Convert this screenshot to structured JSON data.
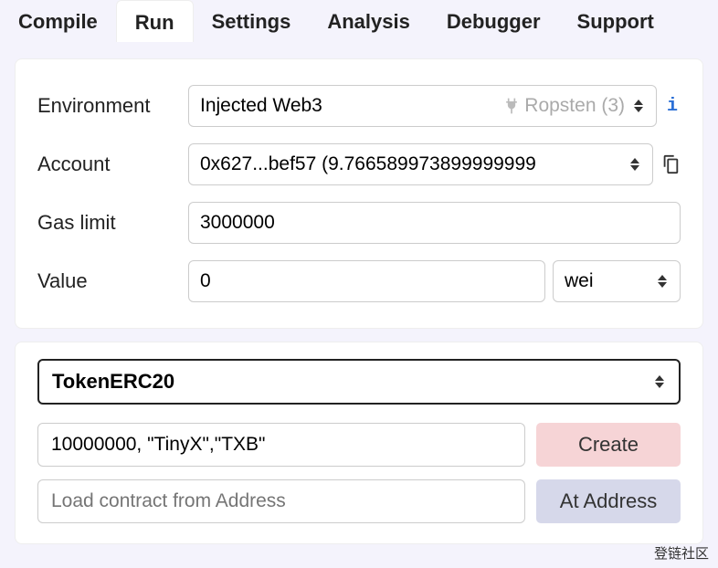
{
  "tabs": {
    "compile": "Compile",
    "run": "Run",
    "settings": "Settings",
    "analysis": "Analysis",
    "debugger": "Debugger",
    "support": "Support"
  },
  "env": {
    "label": "Environment",
    "value": "Injected Web3",
    "network": "Ropsten (3)"
  },
  "account": {
    "label": "Account",
    "value": "0x627...bef57 (9.766589973899999999"
  },
  "gas": {
    "label": "Gas limit",
    "value": "3000000"
  },
  "value": {
    "label": "Value",
    "amount": "0",
    "unit": "wei"
  },
  "contract": {
    "selected": "TokenERC20",
    "ctor_args": "10000000, \"TinyX\",\"TXB\"",
    "create_label": "Create",
    "load_placeholder": "Load contract from Address",
    "ataddress_label": "At Address"
  },
  "watermark": "登链社区"
}
